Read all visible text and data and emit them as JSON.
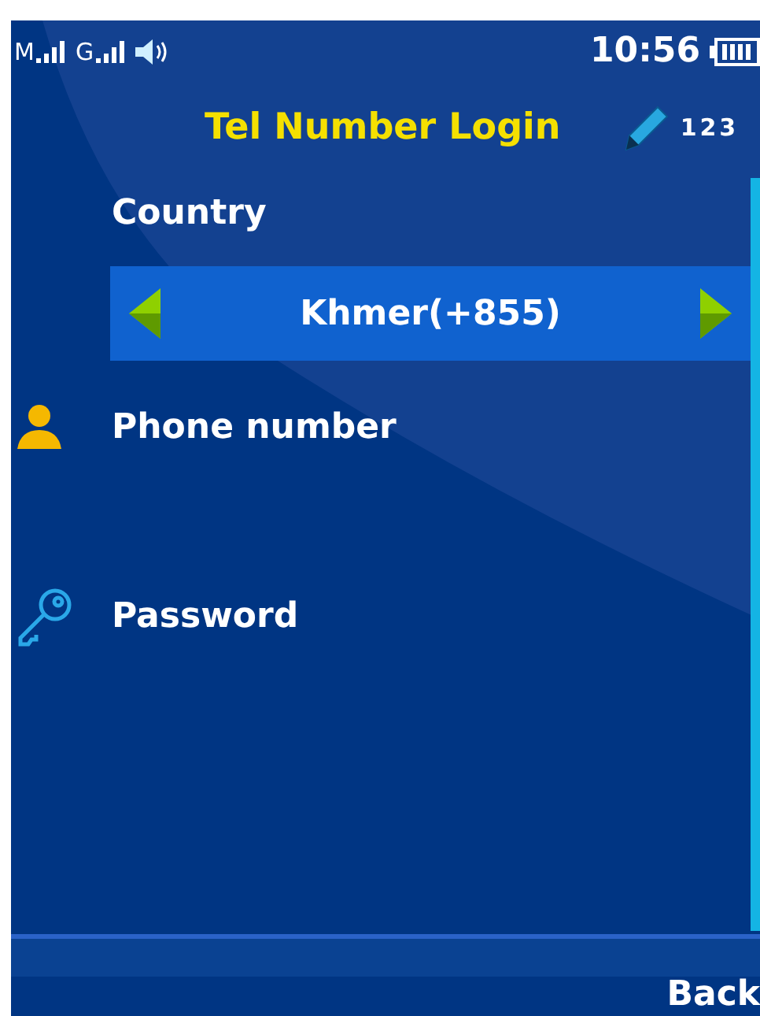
{
  "status_bar": {
    "sim_1": "M",
    "sim_2": "G",
    "time": "10:56"
  },
  "title": "Tel Number Login",
  "input_mode": "123",
  "country": {
    "label": "Country",
    "value": "Khmer(+855)"
  },
  "fields": [
    {
      "kind": "phone",
      "label": "Phone number"
    },
    {
      "kind": "password",
      "label": "Password"
    }
  ],
  "softkeys": {
    "right": "Back"
  }
}
